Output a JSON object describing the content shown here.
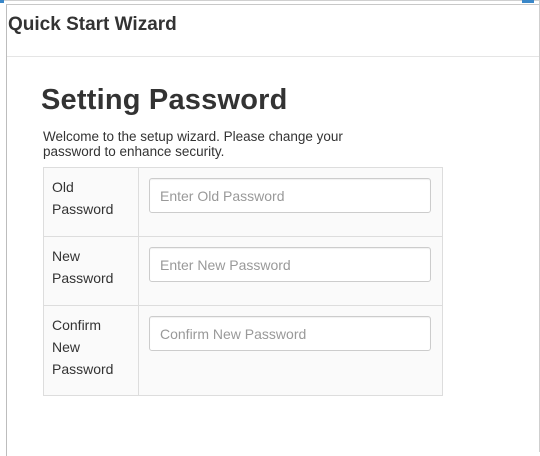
{
  "dialog": {
    "title": "Quick Start Wizard"
  },
  "page": {
    "heading": "Setting Password",
    "intro": "Welcome to the setup wizard. Please change your password to enhance security."
  },
  "form": {
    "fields": [
      {
        "label_line1": "Old",
        "label_line2": "Password",
        "label_line3": "",
        "placeholder": "Enter Old Password",
        "value": ""
      },
      {
        "label_line1": "New",
        "label_line2": "Password",
        "label_line3": "",
        "placeholder": "Enter New Password",
        "value": ""
      },
      {
        "label_line1": "Confirm",
        "label_line2": "New",
        "label_line3": "Password",
        "placeholder": "Confirm New Password",
        "value": ""
      }
    ]
  },
  "colors": {
    "accent": "#3a87c8",
    "text": "#333333",
    "placeholder": "#999999",
    "border": "#dddddd",
    "table_bg": "#fafafa"
  }
}
